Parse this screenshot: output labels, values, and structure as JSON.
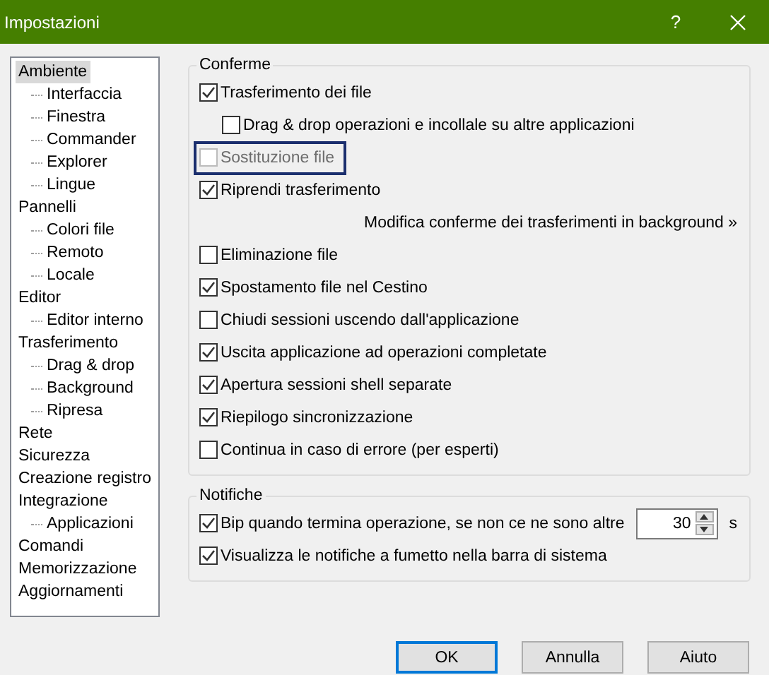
{
  "window": {
    "title": "Impostazioni",
    "help": "?"
  },
  "tree": [
    {
      "label": "Ambiente",
      "selected": true,
      "children": [
        {
          "label": "Interfaccia",
          "selected": false
        },
        {
          "label": "Finestra",
          "selected": false
        },
        {
          "label": "Commander",
          "selected": false
        },
        {
          "label": "Explorer",
          "selected": false
        },
        {
          "label": "Lingue",
          "selected": false
        }
      ]
    },
    {
      "label": "Pannelli",
      "selected": false,
      "children": [
        {
          "label": "Colori file",
          "selected": false
        },
        {
          "label": "Remoto",
          "selected": false
        },
        {
          "label": "Locale",
          "selected": false
        }
      ]
    },
    {
      "label": "Editor",
      "selected": false,
      "children": [
        {
          "label": "Editor interno",
          "selected": false
        }
      ]
    },
    {
      "label": "Trasferimento",
      "selected": false,
      "children": [
        {
          "label": "Drag & drop",
          "selected": false
        },
        {
          "label": "Background",
          "selected": false
        },
        {
          "label": "Ripresa",
          "selected": false
        }
      ]
    },
    {
      "label": "Rete",
      "selected": false
    },
    {
      "label": "Sicurezza",
      "selected": false
    },
    {
      "label": "Creazione registro",
      "selected": false
    },
    {
      "label": "Integrazione",
      "selected": false,
      "children": [
        {
          "label": "Applicazioni",
          "selected": false
        }
      ]
    },
    {
      "label": "Comandi",
      "selected": false
    },
    {
      "label": "Memorizzazione",
      "selected": false
    },
    {
      "label": "Aggiornamenti",
      "selected": false
    }
  ],
  "confirm_group": {
    "title": "Conferme",
    "items": [
      {
        "kind": "checkbox",
        "label": "Trasferimento dei file",
        "checked": true,
        "disabled": false,
        "focused": false,
        "indented": false
      },
      {
        "kind": "checkbox",
        "label": "Drag & drop operazioni e incollale su altre applicazioni",
        "checked": false,
        "disabled": false,
        "focused": false,
        "indented": true
      },
      {
        "kind": "checkbox",
        "label": "Sostituzione file",
        "checked": false,
        "disabled": true,
        "focused": true,
        "indented": false
      },
      {
        "kind": "checkbox",
        "label": "Riprendi trasferimento",
        "checked": true,
        "disabled": false,
        "focused": false,
        "indented": false
      },
      {
        "kind": "link",
        "label": "Modifica conferme dei trasferimenti in background »"
      },
      {
        "kind": "checkbox",
        "label": "Eliminazione file",
        "checked": false,
        "disabled": false,
        "focused": false,
        "indented": false
      },
      {
        "kind": "checkbox",
        "label": "Spostamento file nel Cestino",
        "checked": true,
        "disabled": false,
        "focused": false,
        "indented": false
      },
      {
        "kind": "checkbox",
        "label": "Chiudi sessioni uscendo dall'applicazione",
        "checked": false,
        "disabled": false,
        "focused": false,
        "indented": false
      },
      {
        "kind": "checkbox",
        "label": "Uscita applicazione ad operazioni completate",
        "checked": true,
        "disabled": false,
        "focused": false,
        "indented": false
      },
      {
        "kind": "checkbox",
        "label": "Apertura sessioni shell separate",
        "checked": true,
        "disabled": false,
        "focused": false,
        "indented": false
      },
      {
        "kind": "checkbox",
        "label": "Riepilogo sincronizzazione",
        "checked": true,
        "disabled": false,
        "focused": false,
        "indented": false
      },
      {
        "kind": "checkbox",
        "label": "Continua in caso di errore (per esperti)",
        "checked": false,
        "disabled": false,
        "focused": false,
        "indented": false
      }
    ]
  },
  "notify_group": {
    "title": "Notifiche",
    "beep": {
      "label": "Bip quando termina operazione, se non ce ne sono altre",
      "checked": true,
      "value": "30",
      "unit": "s"
    },
    "balloon": {
      "label": "Visualizza le notifiche a fumetto nella barra di sistema",
      "checked": true
    }
  },
  "buttons": [
    {
      "label": "OK",
      "default": true
    },
    {
      "label": "Annulla",
      "default": false
    },
    {
      "label": "Aiuto",
      "default": false
    }
  ]
}
